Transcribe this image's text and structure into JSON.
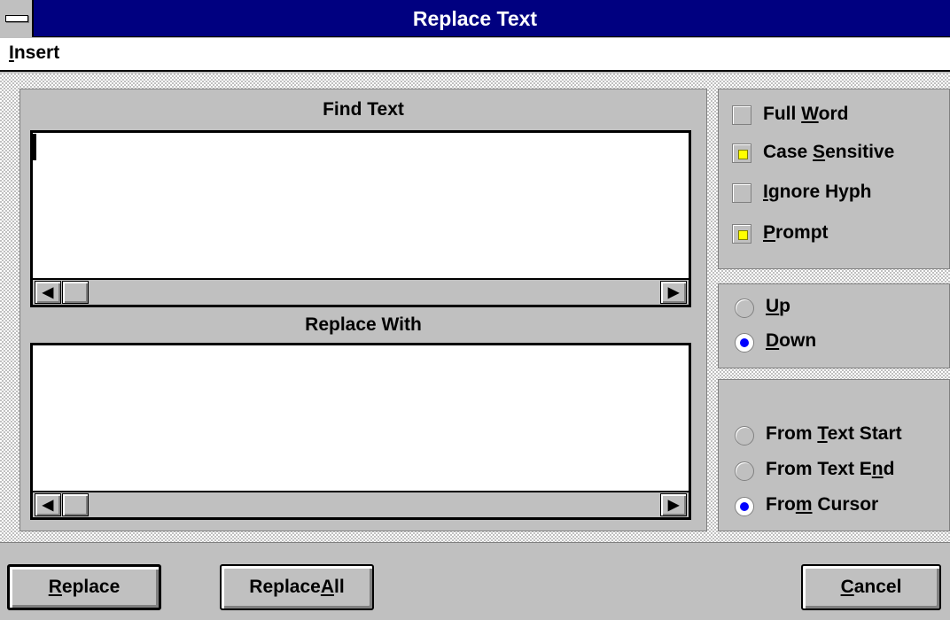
{
  "window": {
    "title": "Replace Text"
  },
  "menu": {
    "insert": {
      "accel": "I",
      "rest": "nsert"
    }
  },
  "find": {
    "label": "Find Text",
    "value": ""
  },
  "replace": {
    "label": "Replace With",
    "value": ""
  },
  "options": [
    {
      "id": "full-word",
      "pre": "Full ",
      "accel": "W",
      "post": "ord",
      "checked": false
    },
    {
      "id": "case-sensitive",
      "pre": "Case ",
      "accel": "S",
      "post": "ensitive",
      "checked": true
    },
    {
      "id": "ignore-hyph",
      "pre": "",
      "accel": "I",
      "post": "gnore Hyph",
      "checked": false
    },
    {
      "id": "prompt",
      "pre": "",
      "accel": "P",
      "post": "rompt",
      "checked": true
    }
  ],
  "direction": [
    {
      "id": "up",
      "pre": "",
      "accel": "U",
      "post": "p",
      "selected": false
    },
    {
      "id": "down",
      "pre": "",
      "accel": "D",
      "post": "own",
      "selected": true
    }
  ],
  "origin": [
    {
      "id": "from-text-start",
      "pre": "From ",
      "accel": "T",
      "post": "ext Start",
      "selected": false
    },
    {
      "id": "from-text-end",
      "pre": "From Text E",
      "accel": "n",
      "post": "d",
      "selected": false
    },
    {
      "id": "from-cursor",
      "pre": "Fro",
      "accel": "m",
      "post": " Cursor",
      "selected": true
    }
  ],
  "buttons": {
    "replace": {
      "pre": "",
      "accel": "R",
      "post": "eplace"
    },
    "replace_all": {
      "pre": "Replace ",
      "accel": "A",
      "post": "ll"
    },
    "cancel": {
      "pre": "",
      "accel": "C",
      "post": "ancel"
    }
  },
  "icons": {
    "left_arrow": "◀",
    "right_arrow": "▶"
  },
  "colors": {
    "title_bar": "#000080",
    "check_mark": "#ffff00",
    "radio_dot": "#0000ff",
    "face": "#c0c0c0"
  }
}
